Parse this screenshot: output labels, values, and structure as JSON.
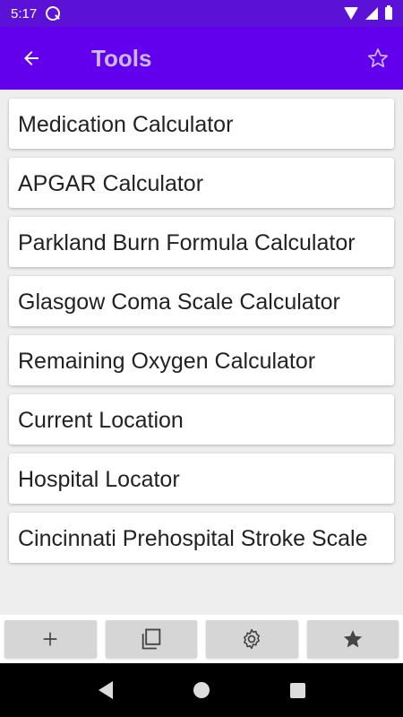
{
  "status_bar": {
    "time": "5:17"
  },
  "app_bar": {
    "title": "Tools"
  },
  "tools": [
    "Medication Calculator",
    "APGAR Calculator",
    "Parkland Burn Formula Calculator",
    "Glasgow Coma Scale Calculator",
    "Remaining Oxygen Calculator",
    "Current Location",
    "Hospital Locator",
    "Cincinnati Prehospital Stroke Scale"
  ],
  "bottom_toolbar": {
    "icons": [
      "add-icon",
      "copy-icon",
      "settings-icon",
      "star-icon"
    ]
  },
  "colors": {
    "status_bar": "#5b12d6",
    "app_bar": "#6200ee",
    "title_text": "#c9b8ff"
  }
}
